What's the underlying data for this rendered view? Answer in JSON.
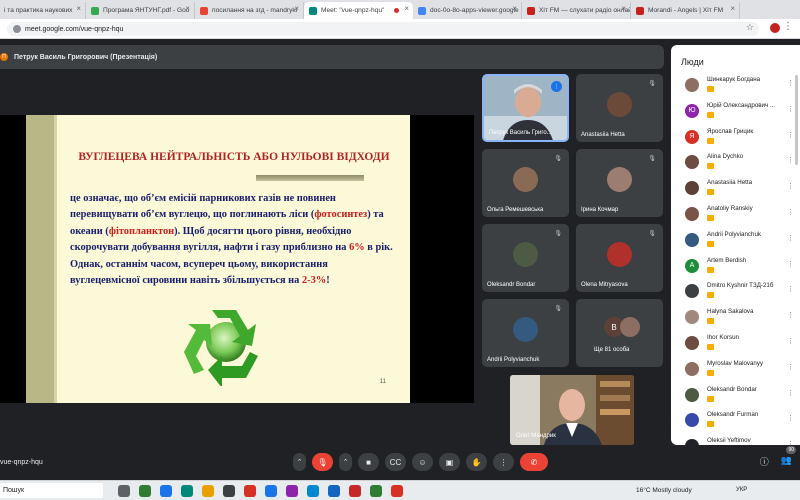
{
  "browser": {
    "tabs": [
      {
        "label": "і та практика наукових",
        "color": "#4285f4",
        "active": false
      },
      {
        "label": "Програма ЯНТУНГ.pdf - Goo",
        "color": "#34a853",
        "active": false
      },
      {
        "label": "посилання на згд - mandryki",
        "color": "#ea4335",
        "active": false
      },
      {
        "label": "Meet: \"vue-qnpz-hqu\"",
        "color": "#00897b",
        "active": true
      },
      {
        "label": "doc-0o-8o-apps-viewer.google",
        "color": "#4285f4",
        "active": false
      },
      {
        "label": "Хіт FM — слухати радіо онлай",
        "color": "#c5221f",
        "active": false
      },
      {
        "label": "Morandi - Angels | Хіт FM",
        "color": "#c5221f",
        "active": false
      }
    ],
    "close_glyph": "×",
    "url": "meet.google.com/vue-qnpz-hqu",
    "star_glyph": "☆",
    "menu_glyph": "⋮"
  },
  "meeting": {
    "presenter_banner": "Петрук Василь Григорович (Презентація)",
    "presenter_dot": "П",
    "code": "vue-qnpz-hqu",
    "participant_count_badge": "90"
  },
  "slide": {
    "title": "ВУГЛЕЦЕВА НЕЙТРАЛЬНІСТЬ АБО НУЛЬОВІ ВІДХОДИ",
    "body": [
      {
        "text": "це означає, що об’єм емісій парникових газів не повинен перевищувати об’єм вуглецю, що поглинають ліси (",
        "red": false
      },
      {
        "text": "фотосинтез",
        "red": true
      },
      {
        "text": ") та океани (",
        "red": false
      },
      {
        "text": "фітопланктон",
        "red": true
      },
      {
        "text": "). Щоб досягти цього рівня, необхідно скорочувати добування вугілля, нафти і газу приблизно на ",
        "red": false
      },
      {
        "text": "6%",
        "red": true
      },
      {
        "text": " в рік. Однак, останнім часом, всупереч цьому, використання вуглецевмісної сировини навіть збільшується на ",
        "red": false
      },
      {
        "text": "2-3%",
        "red": true
      },
      {
        "text": "!",
        "red": false
      }
    ],
    "page_number": "11"
  },
  "tiles": [
    {
      "name": "Петрук Василь Григо...",
      "type": "video",
      "active": true
    },
    {
      "name": "Anastasiia Hetta",
      "type": "photo",
      "color": "#6b4a3a"
    },
    {
      "name": "Ольга Ремешевська",
      "type": "photo",
      "color": "#8a6a55"
    },
    {
      "name": "Ірина Кочмар",
      "type": "photo",
      "color": "#9b7e70"
    },
    {
      "name": "Oleksandr Bondar",
      "type": "photo",
      "color": "#4d5a44"
    },
    {
      "name": "Olena Mitryasova",
      "type": "photo",
      "color": "#b0302b"
    },
    {
      "name": "Andrii Polyvianchuk",
      "type": "photo",
      "color": "#345a80"
    },
    {
      "name": "Ще 81 особа",
      "type": "more",
      "letter": "В"
    }
  ],
  "self_video": {
    "name": "Олег Мандрик"
  },
  "people_panel": {
    "title": "Люди",
    "more_glyph": "⋮",
    "people": [
      {
        "name": "Шинкарук Богдана",
        "initial": "",
        "color": "#8d6e63"
      },
      {
        "name": "Юрій Олександрович ...",
        "initial": "Ю",
        "color": "#8e24aa"
      },
      {
        "name": "Ярослав Грицик",
        "initial": "Я",
        "color": "#d93025"
      },
      {
        "name": "Alina Dychko",
        "initial": "",
        "color": "#6d4c41"
      },
      {
        "name": "Anastasiia Hetta",
        "initial": "",
        "color": "#5d4037"
      },
      {
        "name": "Anatoliy Ranskiy",
        "initial": "",
        "color": "#795548"
      },
      {
        "name": "Andrii Polyvianchuk",
        "initial": "",
        "color": "#345a80"
      },
      {
        "name": "Artem Berdish",
        "initial": "A",
        "color": "#1e8e3e"
      },
      {
        "name": "Dmitro Kyshnir TЗД-21б",
        "initial": "",
        "color": "#3c4043"
      },
      {
        "name": "Halyna Sakalova",
        "initial": "",
        "color": "#a1887f"
      },
      {
        "name": "Ihor Korsun",
        "initial": "",
        "color": "#6d4c41"
      },
      {
        "name": "Myroslav Malovanyy",
        "initial": "",
        "color": "#8d6e63"
      },
      {
        "name": "Oleksandr Bondar",
        "initial": "",
        "color": "#4d5a44"
      },
      {
        "name": "Oleksandr Furman",
        "initial": "",
        "color": "#3949ab"
      },
      {
        "name": "Oleksii Yeftimov",
        "initial": "",
        "color": "#202124"
      }
    ]
  },
  "controls": [
    {
      "name": "mic-dropdown-button",
      "glyph": "⌃",
      "style": ""
    },
    {
      "name": "mic-off-button",
      "glyph": "🎙",
      "style": "red"
    },
    {
      "name": "camera-dropdown-button",
      "glyph": "⌃",
      "style": ""
    },
    {
      "name": "camera-button",
      "glyph": "■",
      "style": ""
    },
    {
      "name": "captions-button",
      "glyph": "CC",
      "style": ""
    },
    {
      "name": "emoji-button",
      "glyph": "☺",
      "style": ""
    },
    {
      "name": "present-button",
      "glyph": "▣",
      "style": ""
    },
    {
      "name": "raise-hand-button",
      "glyph": "✋",
      "style": ""
    },
    {
      "name": "more-options-button",
      "glyph": "⋮",
      "style": ""
    },
    {
      "name": "leave-call-button",
      "glyph": "✆",
      "style": "end"
    }
  ],
  "right_controls": {
    "info": "ⓘ",
    "people": "👥"
  },
  "taskbar": {
    "search": "Пошук",
    "weather": "16°C  Mostly cloudy",
    "lang": "УКР",
    "apps": [
      "#5f6368",
      "#2e7d32",
      "#1a73e8",
      "#00897b",
      "#e8a100",
      "#3c4043",
      "#d93025",
      "#1a73e8",
      "#8e24aa",
      "#0288d1",
      "#1565c0",
      "#c62828",
      "#2e7d32",
      "#d93025"
    ]
  }
}
